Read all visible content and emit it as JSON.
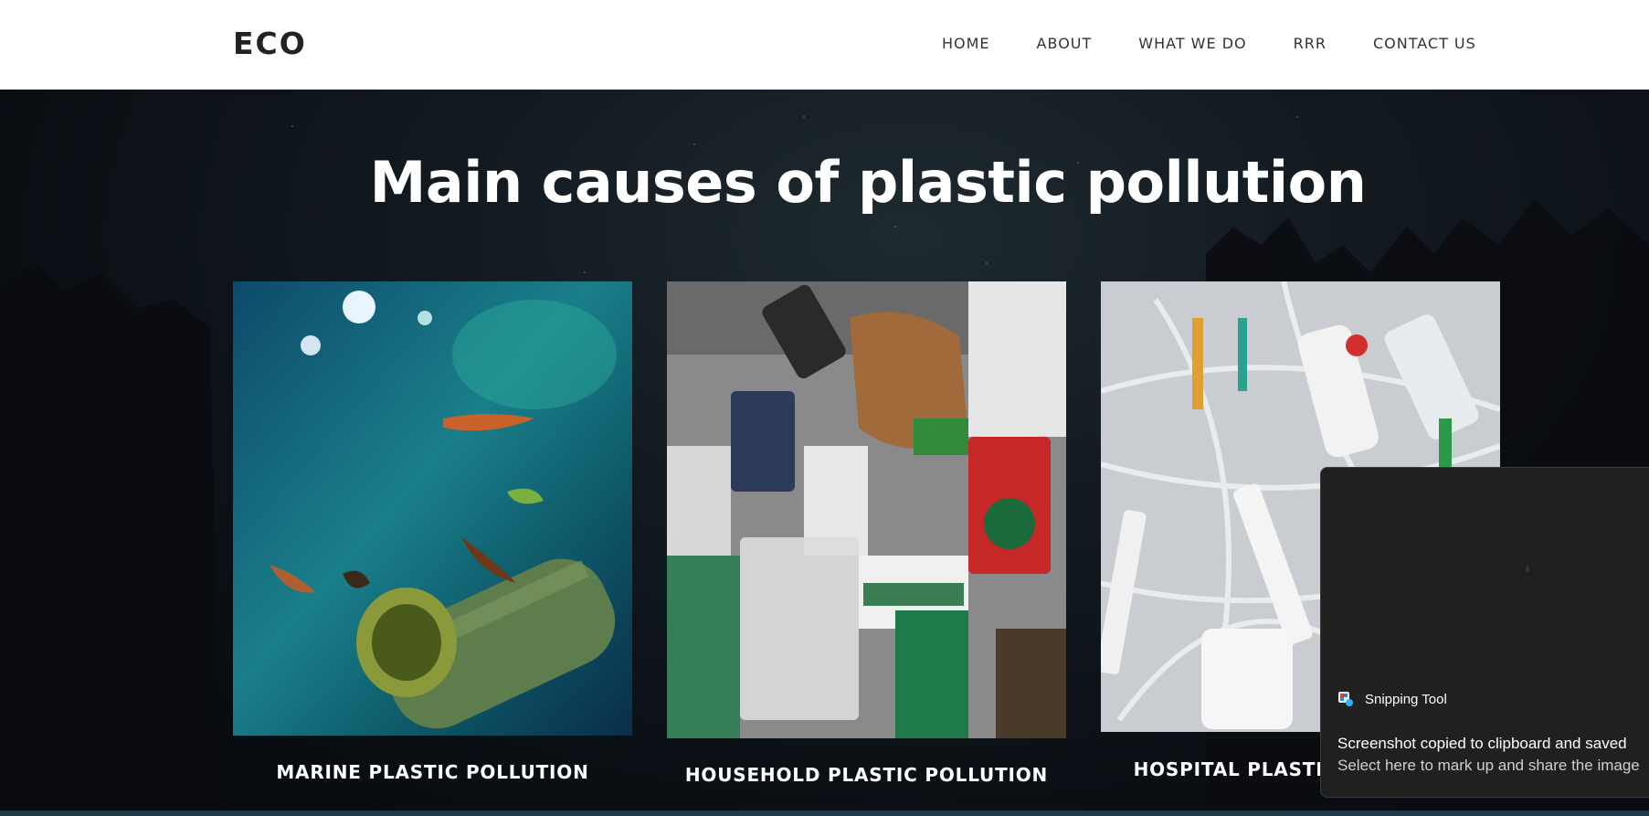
{
  "header": {
    "logo": "ECO",
    "nav": [
      "HOME",
      "ABOUT",
      "WHAT WE DO",
      "RRR",
      "CONTACT US"
    ]
  },
  "hero": {
    "title": "Main causes of plastic pollution"
  },
  "cards": [
    {
      "label": "MARINE PLASTIC POLLUTION",
      "image": "marine-plastic-bottle-underwater"
    },
    {
      "label": "HOUSEHOLD PLASTIC POLLUTION",
      "image": "household-plastic-cups-pile"
    },
    {
      "label": "HOSPITAL PLASTIC POLLUTION",
      "image": "hospital-syringes-tubes"
    }
  ],
  "toast": {
    "app": "Snipping Tool",
    "icon": "snipping-tool-icon",
    "title": "Screenshot copied to clipboard and saved",
    "body": "Select here to mark up and share the image"
  },
  "colors": {
    "header_bg": "#ffffff",
    "hero_bg": "#0d1117",
    "toast_bg": "#202020"
  }
}
